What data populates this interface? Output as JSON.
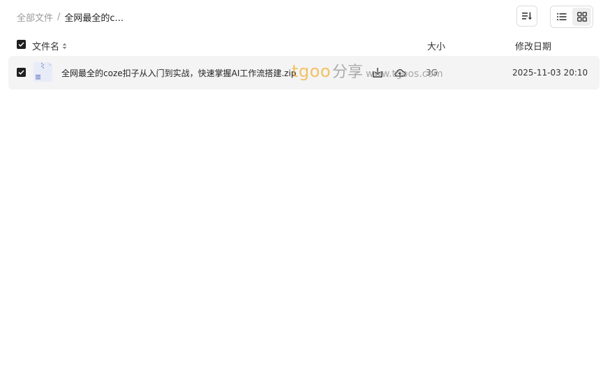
{
  "breadcrumb": {
    "root": "全部文件",
    "separator": "/",
    "current": "全网最全的c..."
  },
  "toolbar": {
    "sort_icon": "sort-icon",
    "list_view_icon": "list-view-icon",
    "grid_view_icon": "grid-view-icon"
  },
  "header": {
    "name": "文件名",
    "size": "大小",
    "modified": "修改日期"
  },
  "files": [
    {
      "name": "全网最全的coze扣子从入门到实战，快速掌握AI工作流搭建.zip",
      "size": "3G",
      "modified": "2025-11-03 20:10",
      "icon": "zip-file-icon",
      "selected": true
    }
  ],
  "watermark": {
    "brand": "tgoo",
    "cn": "分享",
    "url": "www.tgoos.com"
  },
  "colors": {
    "brand": "#f2b233",
    "row_bg": "#f4f4f5",
    "checkbox": "#1f1f1f"
  }
}
